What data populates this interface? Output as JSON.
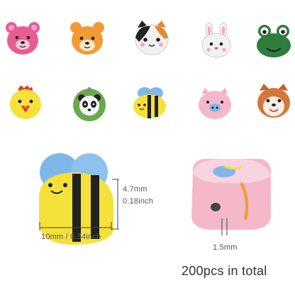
{
  "beads": {
    "row1": [
      "pink-bear-icon",
      "orange-bear-icon",
      "cat-icon",
      "bunny-icon",
      "frog-icon"
    ],
    "row2": [
      "chicken-icon",
      "panda-icon",
      "bee-icon",
      "pig-icon",
      "dog-icon"
    ]
  },
  "bee_detail": {
    "height_mm": "4.7mm",
    "height_inch": "0.18inch",
    "width_label": "10mm / 0.34inch"
  },
  "hole_detail": {
    "hole_label": "1.5mm"
  },
  "caption": "200pcs in total",
  "colors": {
    "pink": "#e95c93",
    "orange": "#f29a35",
    "green": "#2e7d3f",
    "yellow": "#f6e03a",
    "blue_wing": "#7fb8e8",
    "light_pink": "#f5b8c8"
  }
}
